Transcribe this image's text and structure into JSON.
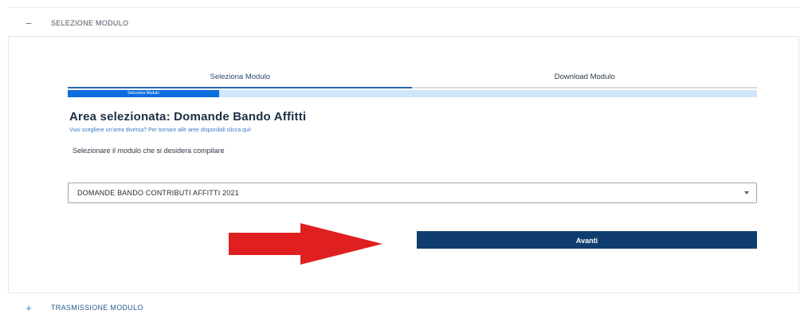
{
  "sections": [
    {
      "toggle": "−",
      "title": "SELEZIONE MODULO",
      "expanded": true
    },
    {
      "toggle": "+",
      "title": "TRASMISSIONE MODULO",
      "expanded": false
    }
  ],
  "stepper": {
    "steps": [
      {
        "label": "Seleziona Modulo",
        "active": true
      },
      {
        "label": "Download Modulo",
        "active": false
      }
    ],
    "progress_label": "Seleziona Modulo",
    "progress_fraction": 0.22
  },
  "area": {
    "title": "Area selezionata: Domande Bando Affitti",
    "change_link": "Vuoi scegliere un'area diversa? Per tornare alle aree disponibili clicca qui!",
    "select_hint": "Selezionare il modulo che si desidera compilare"
  },
  "module_select": {
    "value": "DOMANDE BANDO CONTRIBUTI AFFITTI 2021"
  },
  "actions": {
    "next_label": "Avanti"
  },
  "annotation": {
    "arrow_color": "#e02020",
    "arrow_icon": "arrow-right-icon"
  },
  "colors": {
    "primary": "#0f3e6e",
    "progress": "#0d6ddd",
    "progress_bg": "#cfe6fb",
    "link": "#3a7ac8"
  }
}
